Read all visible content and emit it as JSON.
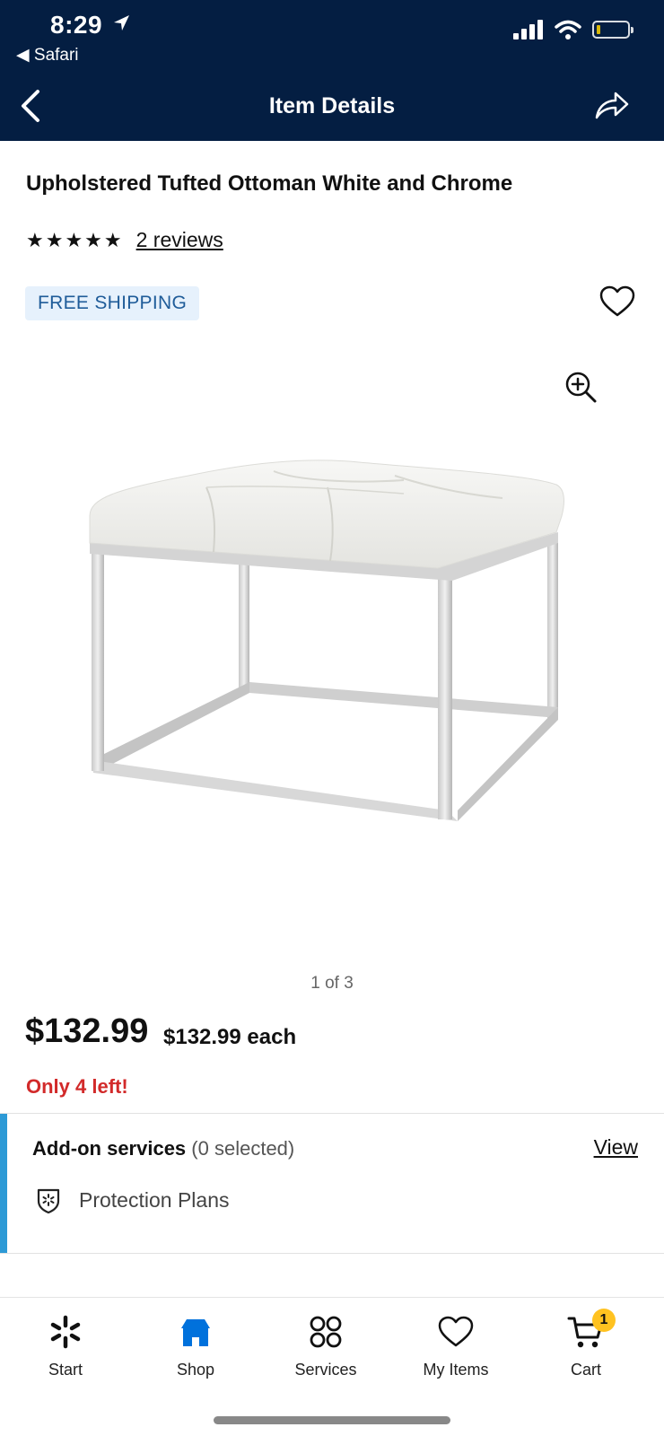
{
  "status_bar": {
    "time": "8:29",
    "back_app": "◀ Safari"
  },
  "nav": {
    "title": "Item Details",
    "back_icon": "chevron-left-icon",
    "share_icon": "share-arrow-icon"
  },
  "product": {
    "title": "Upholstered Tufted Ottoman White and Chrome",
    "stars": "★★★★★",
    "rating": 5,
    "reviews_label": "2 reviews",
    "shipping_badge": "FREE SHIPPING",
    "image_pager": "1 of 3",
    "price": "$132.99",
    "unit_price": "$132.99 each",
    "stock_notice": "Only 4 left!"
  },
  "addon": {
    "title": "Add-on services",
    "selected": "(0 selected)",
    "view_label": "View",
    "plans_label": "Protection Plans"
  },
  "tabs": [
    {
      "label": "Start",
      "icon": "spark-icon"
    },
    {
      "label": "Shop",
      "icon": "store-icon"
    },
    {
      "label": "Services",
      "icon": "services-grid-icon"
    },
    {
      "label": "My Items",
      "icon": "heart-icon"
    },
    {
      "label": "Cart",
      "icon": "cart-icon",
      "badge": "1"
    }
  ],
  "colors": {
    "header_bg": "#041e42",
    "accent_blue": "#0071dc",
    "stock_red": "#d22a2a",
    "badge_yellow": "#ffc220",
    "shipping_bg": "#e6f1fc"
  }
}
